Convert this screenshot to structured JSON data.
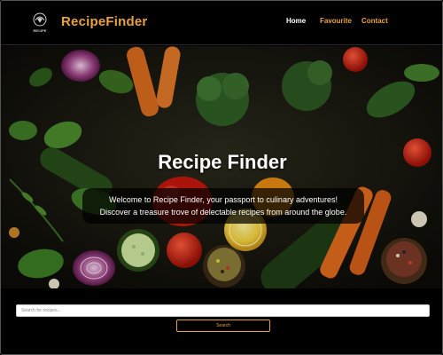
{
  "navbar": {
    "logo_text": "RECIPE",
    "brand": "RecipeFinder",
    "links": [
      {
        "label": "Home",
        "active": true
      },
      {
        "label": "Favourite",
        "active": false
      },
      {
        "label": "Contact",
        "active": false
      }
    ]
  },
  "hero": {
    "title": "Recipe Finder",
    "subtitle_line1": "Welcome to Recipe Finder, your passport to culinary adventures!",
    "subtitle_line2": "Discover a treasure trove of delectable recipes from around the globe."
  },
  "search": {
    "placeholder": "Search for recipes...",
    "value": "",
    "button_label": "Search"
  },
  "colors": {
    "accent": "#e8a33c",
    "background": "#000000",
    "text": "#ffffff"
  }
}
